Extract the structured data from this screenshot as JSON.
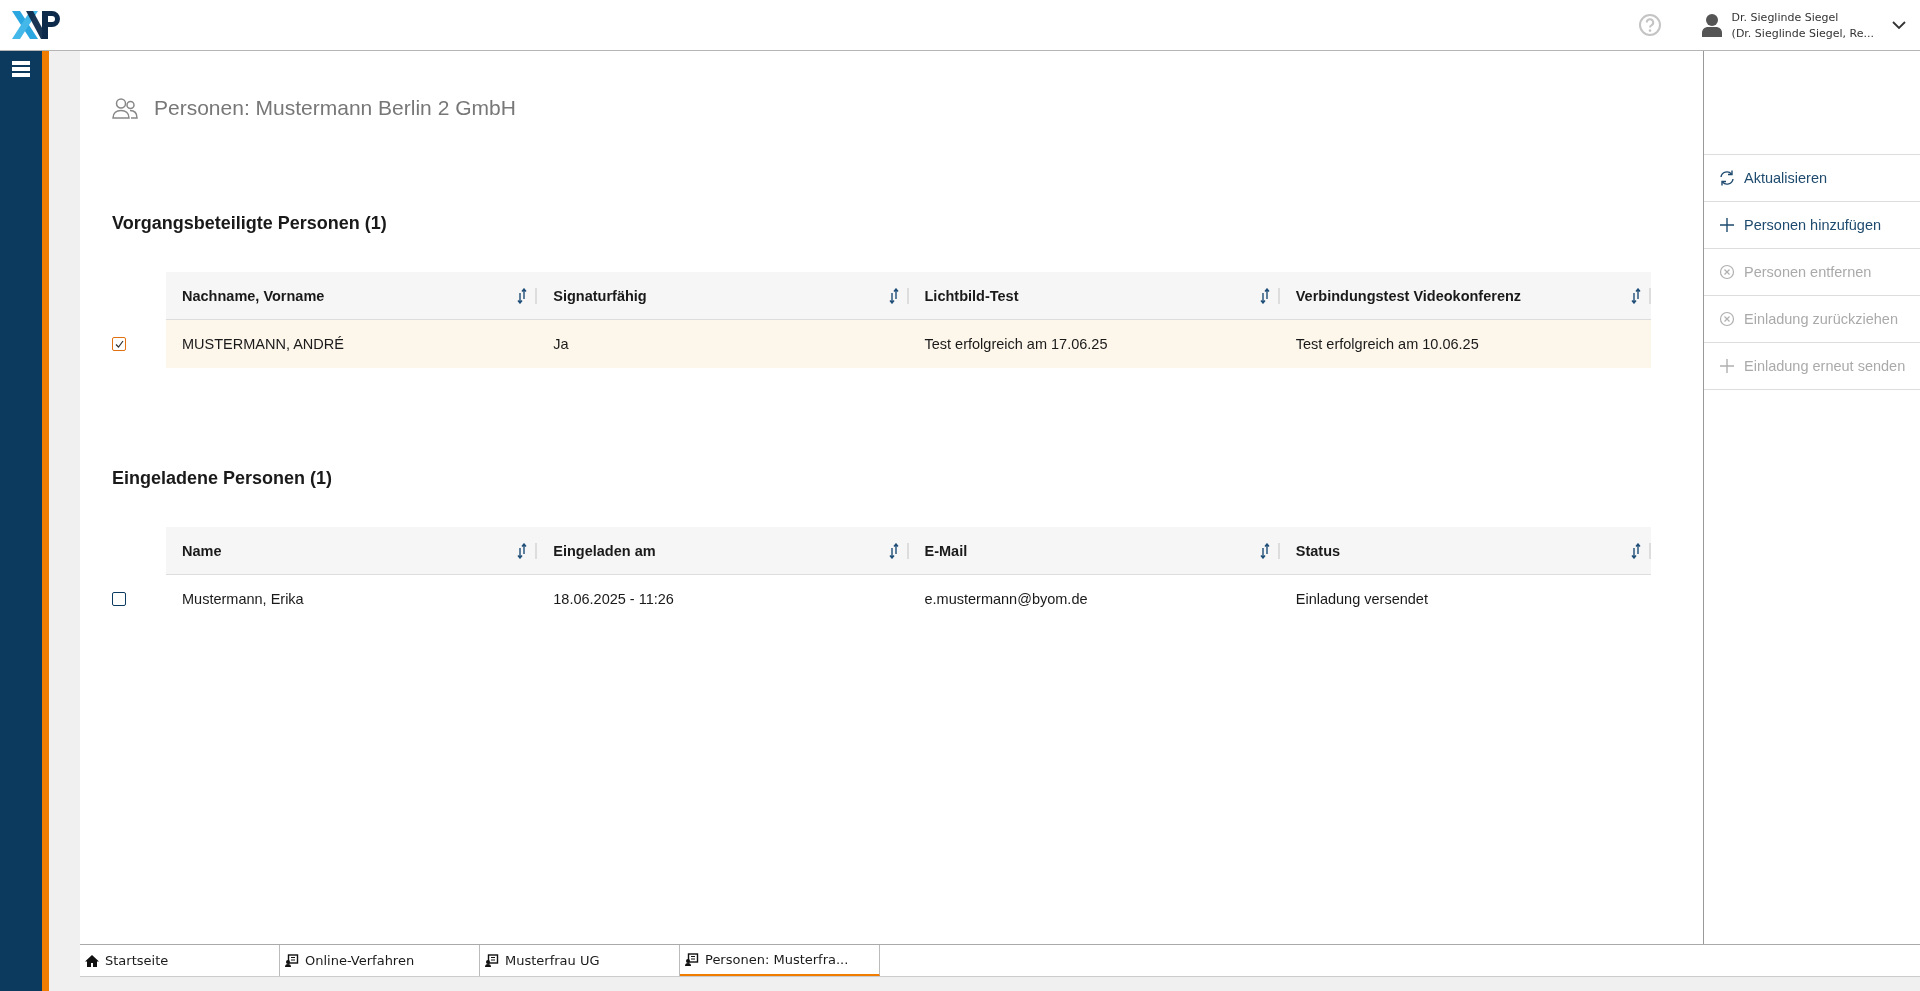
{
  "header": {
    "user_name": "Dr. Sieglinde Siegel",
    "user_role": "(Dr. Sieglinde Siegel, Re..."
  },
  "page_title": "Personen: Mustermann Berlin 2 GmbH",
  "sections": [
    {
      "title": "Vorgangsbeteiligte Personen (1)",
      "columns": [
        "Nachname, Vorname",
        "Signaturfähig",
        "Lichtbild-Test",
        "Verbindungstest Videokonferenz"
      ],
      "rows": [
        {
          "checked": true,
          "selected": true,
          "cells": [
            "MUSTERMANN, ANDRÉ",
            "Ja",
            "Test erfolgreich am 17.06.25",
            "Test erfolgreich am 10.06.25"
          ]
        }
      ]
    },
    {
      "title": "Eingeladene Personen (1)",
      "columns": [
        "Name",
        "Eingeladen am",
        "E-Mail",
        "Status"
      ],
      "rows": [
        {
          "checked": false,
          "selected": false,
          "cells": [
            "Mustermann, Erika",
            "18.06.2025 - 11:26",
            "e.mustermann@byom.de",
            "Einladung versendet"
          ]
        }
      ]
    }
  ],
  "actions": [
    {
      "kind": "refresh",
      "label": "Aktualisieren",
      "disabled": false
    },
    {
      "kind": "add",
      "label": "Personen hinzufügen",
      "disabled": false
    },
    {
      "kind": "remove",
      "label": "Personen entfernen",
      "disabled": true
    },
    {
      "kind": "remove",
      "label": "Einladung zurückziehen",
      "disabled": true
    },
    {
      "kind": "add",
      "label": "Einladung erneut senden",
      "disabled": true
    }
  ],
  "tabs": [
    {
      "kind": "home",
      "label": "Startseite",
      "selected": false
    },
    {
      "kind": "case",
      "label": "Online-Verfahren",
      "selected": false
    },
    {
      "kind": "case",
      "label": "Musterfrau UG",
      "selected": false
    },
    {
      "kind": "case",
      "label": "Personen: Musterfra...",
      "selected": true
    }
  ]
}
